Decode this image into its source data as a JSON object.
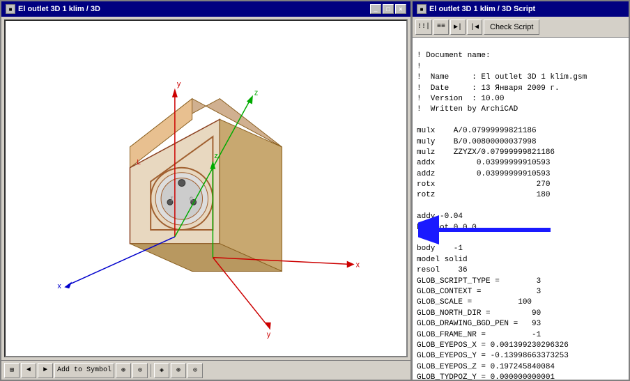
{
  "left": {
    "title": "El outlet 3D 1 klim / 3D",
    "titlebar_icon": "■",
    "controls": [
      "_",
      "□",
      "×"
    ]
  },
  "right": {
    "title": "El outlet 3D 1 klim / 3D Script",
    "check_script_label": "Check Script",
    "toolbar_icons": [
      "!!|",
      "≡≡",
      "▶|",
      "|◀"
    ],
    "script_lines": [
      "! Document name:",
      "!",
      "!  Name     : El outlet 3D 1 klim.gsm",
      "!  Date     : 13 Января 2009 г.",
      "!  Version  : 10.00",
      "!  Written by ArchiCAD",
      "",
      "mulx    A/0.07999999821186",
      "muly    B/0.00800000037998",
      "mulz    ZZYZX/0.07999999821186",
      "addx         0.03999999910593",
      "addz         0.03999999910593",
      "rotx                      270",
      "rotz                      180",
      "",
      "addy -0.04",
      "hotspot 0,0,0",
      "",
      "body    -1",
      "model solid",
      "resol    36",
      "GLOB_SCRIPT_TYPE =        3",
      "GLOB_CONTEXT =            3",
      "GLOB_SCALE =          100",
      "GLOB_NORTH_DIR =         90",
      "GLOB_DRAWING_BGD_PEN =   93",
      "GLOB_FRAME_NR =          -1",
      "GLOB_EYEPOS_X = 0.001399230296326",
      "GLOB_EYEPOS_Y = -0.13998663373253",
      "GLOB_EYEPOS_Z = 0.197245840084",
      "GLOB_TYDPOZ_Y = 0.000000000001"
    ]
  },
  "bottom_toolbar": {
    "buttons": [
      "⊞",
      "◄",
      "►",
      "Add to Symbol",
      "⊕",
      "⊙",
      "◈",
      "⊕",
      "⊙"
    ]
  }
}
